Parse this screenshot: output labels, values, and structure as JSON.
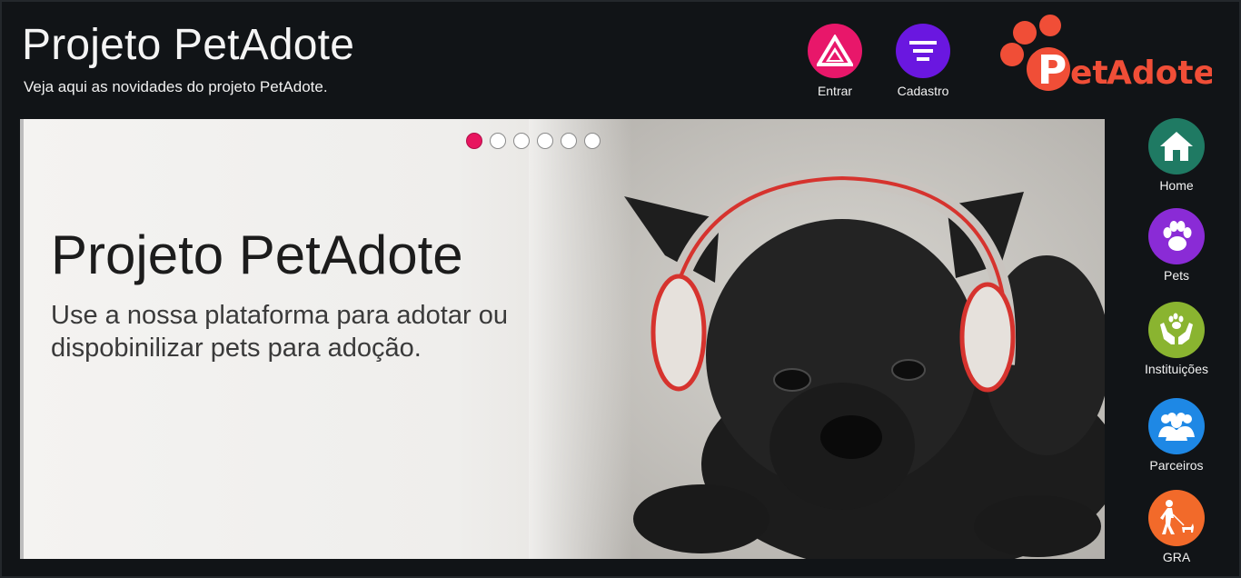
{
  "header": {
    "title": "Projeto PetAdote",
    "subtitle": "Veja aqui as novidades do projeto PetAdote."
  },
  "top_actions": [
    {
      "label": "Entrar",
      "icon": "login-triangle-icon",
      "color": "#e8176a"
    },
    {
      "label": "Cadastro",
      "icon": "menu-lines-icon",
      "color": "#6a17e0"
    }
  ],
  "logo": {
    "text": "PetAdote",
    "colors": {
      "paw": "#f04e37",
      "text_green": "#2e8b3a"
    }
  },
  "slider": {
    "title": "Projeto PetAdote",
    "text": "Use a nossa plataforma para adotar ou dispobinilizar pets para adoção.",
    "active_index": 0,
    "dot_count": 6,
    "image_alt": "black puppy wearing headphones",
    "accent": "#e8155f"
  },
  "side_nav": [
    {
      "label": "Home",
      "icon": "home-icon",
      "color": "#1f7a63"
    },
    {
      "label": "Pets",
      "icon": "paw-icon",
      "color": "#8a2bd6"
    },
    {
      "label": "Instituições",
      "icon": "hands-paw-icon",
      "color": "#8ab430"
    },
    {
      "label": "Parceiros",
      "icon": "group-icon",
      "color": "#1e88e5"
    },
    {
      "label": "GRA",
      "icon": "walking-dog-icon",
      "color": "#f26a2a"
    }
  ]
}
